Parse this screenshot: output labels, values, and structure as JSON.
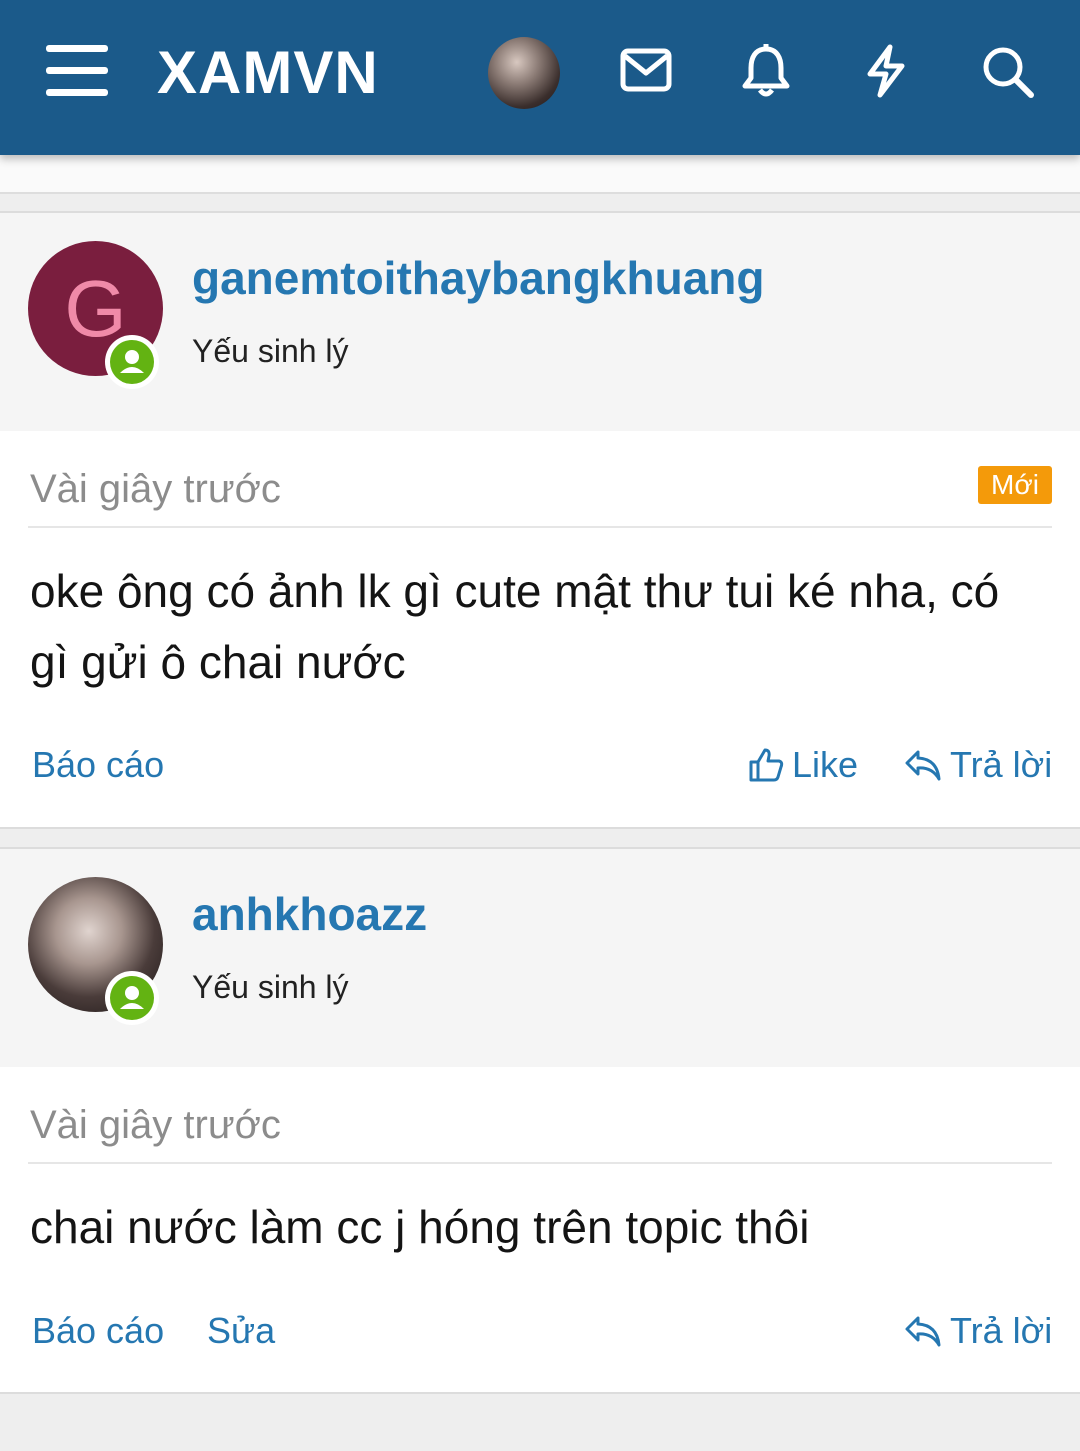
{
  "header": {
    "logo": "XAMVN",
    "icons": [
      "menu-icon",
      "avatar",
      "mail-icon",
      "bell-icon",
      "bolt-icon",
      "search-icon"
    ],
    "bg_color": "#1b5a8a"
  },
  "posts": [
    {
      "avatar_letter": "G",
      "username": "ganemtoithaybangkhuang",
      "user_title": "Yếu sinh lý",
      "time": "Vài giây trước",
      "badge": "Mới",
      "message": "oke ông có ảnh lk gì cute mật thư tui ké nha, có gì gửi ô chai nước",
      "actions": {
        "report": "Báo cáo",
        "like": "Like",
        "reply": "Trả lời"
      }
    },
    {
      "username": "anhkhoazz",
      "user_title": "Yếu sinh lý",
      "time": "Vài giây trước",
      "message": "chai nước làm cc j hóng trên topic thôi",
      "actions": {
        "report": "Báo cáo",
        "edit": "Sửa",
        "reply": "Trả lời"
      }
    }
  ],
  "colors": {
    "link": "#2577b1",
    "online": "#63b312",
    "badge": "#f49a0a"
  }
}
